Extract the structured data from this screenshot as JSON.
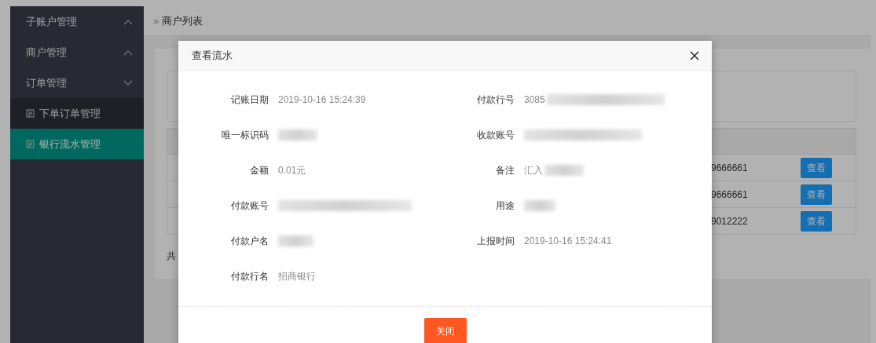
{
  "sidebar": {
    "items": [
      {
        "label": "子账户管理",
        "expanded": false
      },
      {
        "label": "商户管理",
        "expanded": false
      },
      {
        "label": "订单管理",
        "expanded": true,
        "children": [
          {
            "label": "下单订单管理",
            "selected": false
          },
          {
            "label": "银行流水管理",
            "selected": true
          }
        ]
      }
    ]
  },
  "breadcrumb_separator": "»",
  "breadcrumb": "商户列表",
  "table": {
    "rows": [
      {
        "column_1": "9666661",
        "action": "查看"
      },
      {
        "column_1": "9666661",
        "action": "查看"
      },
      {
        "column_1": "9012222",
        "action": "查看"
      }
    ],
    "footer": "共"
  },
  "modal": {
    "title": "查看流水",
    "fields": [
      {
        "label": "记账日期",
        "value": "2019-10-16 15:24:39"
      },
      {
        "label": "付款行号",
        "value": "3085",
        "redacted": true
      },
      {
        "label": "唯一标识码",
        "redacted": true
      },
      {
        "label": "收款账号",
        "redacted": true
      },
      {
        "label": "金额",
        "value": "0.01元"
      },
      {
        "label": "备注",
        "value": "汇入",
        "redacted": true
      },
      {
        "label": "付款账号",
        "redacted": true
      },
      {
        "label": "用途",
        "redacted": true
      },
      {
        "label": "付款户名",
        "redacted": true
      },
      {
        "label": "上报时间",
        "value": "2019-10-16 15:24:41"
      },
      {
        "label": "付款行名",
        "value": "招商银行"
      }
    ],
    "button": "关闭"
  }
}
